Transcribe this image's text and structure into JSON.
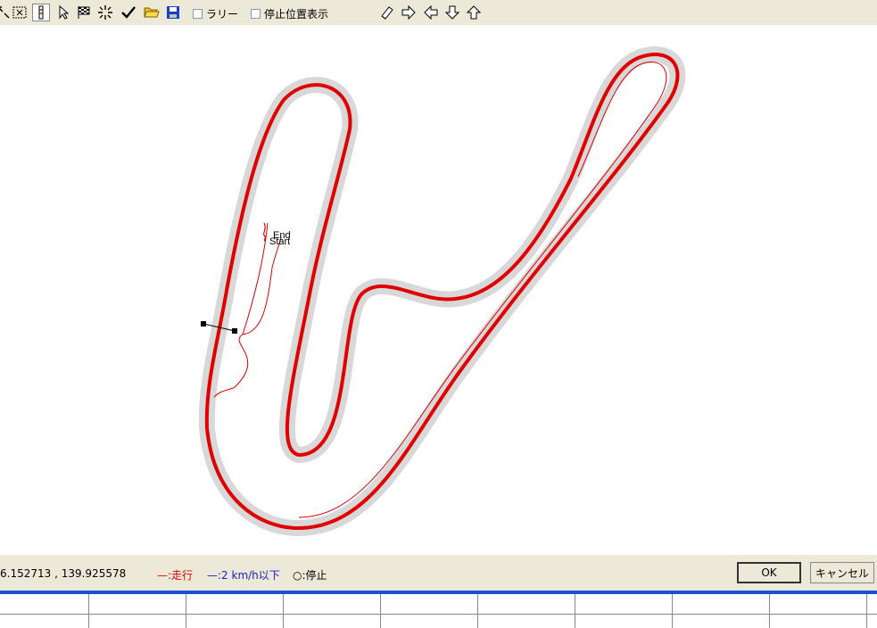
{
  "toolbar": {
    "icons": [
      "fit-screen-icon",
      "zoom-area-icon",
      "vertical-scroll-icon",
      "pointer-pick-icon",
      "checkered-flag-icon",
      "sparkle-icon",
      "checkmark-icon",
      "open-folder-icon",
      "save-disk-icon"
    ],
    "rally_label": "ラリー",
    "stop_position_label": "停止位置表示",
    "nav_icons": [
      "eraser-icon",
      "arrow-right-icon",
      "arrow-left-icon",
      "arrow-down-icon",
      "arrow-up-icon"
    ]
  },
  "map": {
    "end_label": "End",
    "start_label": "Start"
  },
  "status": {
    "coordinates": "6.152713 , 139.925578",
    "legend_run": "—:走行",
    "legend_slow": "—:2 km/h以下",
    "legend_stop": "○:停止",
    "colors": {
      "run": "#e00000",
      "slow": "#1a1ad0",
      "stop": "#000000"
    }
  },
  "buttons": {
    "ok": "OK",
    "cancel": "キャンセル"
  }
}
